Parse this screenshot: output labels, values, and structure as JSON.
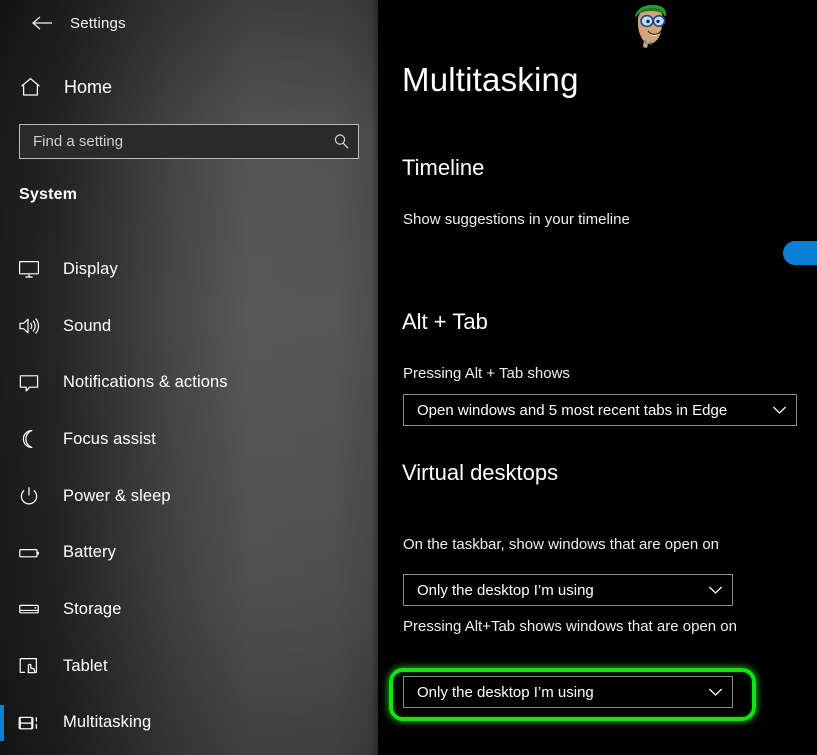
{
  "window": {
    "title": "Settings",
    "back_icon": "back-arrow-icon"
  },
  "sidebar": {
    "home": {
      "label": "Home",
      "icon": "home-icon"
    },
    "search": {
      "placeholder": "Find a setting",
      "value": "",
      "icon": "search-icon"
    },
    "group_title": "System",
    "items": [
      {
        "label": "Display",
        "icon": "monitor-icon",
        "selected": false
      },
      {
        "label": "Sound",
        "icon": "speaker-icon",
        "selected": false
      },
      {
        "label": "Notifications & actions",
        "icon": "chat-bubble-icon",
        "selected": false
      },
      {
        "label": "Focus assist",
        "icon": "moon-icon",
        "selected": false
      },
      {
        "label": "Power & sleep",
        "icon": "power-icon",
        "selected": false
      },
      {
        "label": "Battery",
        "icon": "battery-icon",
        "selected": false
      },
      {
        "label": "Storage",
        "icon": "drive-icon",
        "selected": false
      },
      {
        "label": "Tablet",
        "icon": "tablet-hand-icon",
        "selected": false
      },
      {
        "label": "Multitasking",
        "icon": "multitasking-icon",
        "selected": true
      }
    ]
  },
  "main": {
    "page_title": "Multitasking",
    "mascot_icon": "cartoon-character-watermark",
    "sections": {
      "timeline": {
        "heading": "Timeline",
        "setting_label": "Show suggestions in your timeline",
        "toggle_state": "On",
        "toggle_on": true
      },
      "alt_tab": {
        "heading": "Alt + Tab",
        "setting_label": "Pressing Alt + Tab shows",
        "dropdown_value": "Open windows and 5 most recent tabs in Edge",
        "dropdown_icon": "chevron-down-icon"
      },
      "virtual_desktops": {
        "heading": "Virtual desktops",
        "taskbar_label": "On the taskbar, show windows that are open on",
        "taskbar_dropdown_value": "Only the desktop I’m using",
        "alttab_label": "Pressing Alt+Tab shows windows that are open on",
        "alttab_dropdown_value": "Only the desktop I’m using",
        "dropdown_icon": "chevron-down-icon"
      }
    }
  },
  "annotation": {
    "highlight_color": "#15e215",
    "target": "virtual-desktops-alttab-dropdown"
  },
  "colors": {
    "accent_blue": "#0a7fd6",
    "panel_black": "#000000",
    "highlight_green": "#15e215"
  }
}
